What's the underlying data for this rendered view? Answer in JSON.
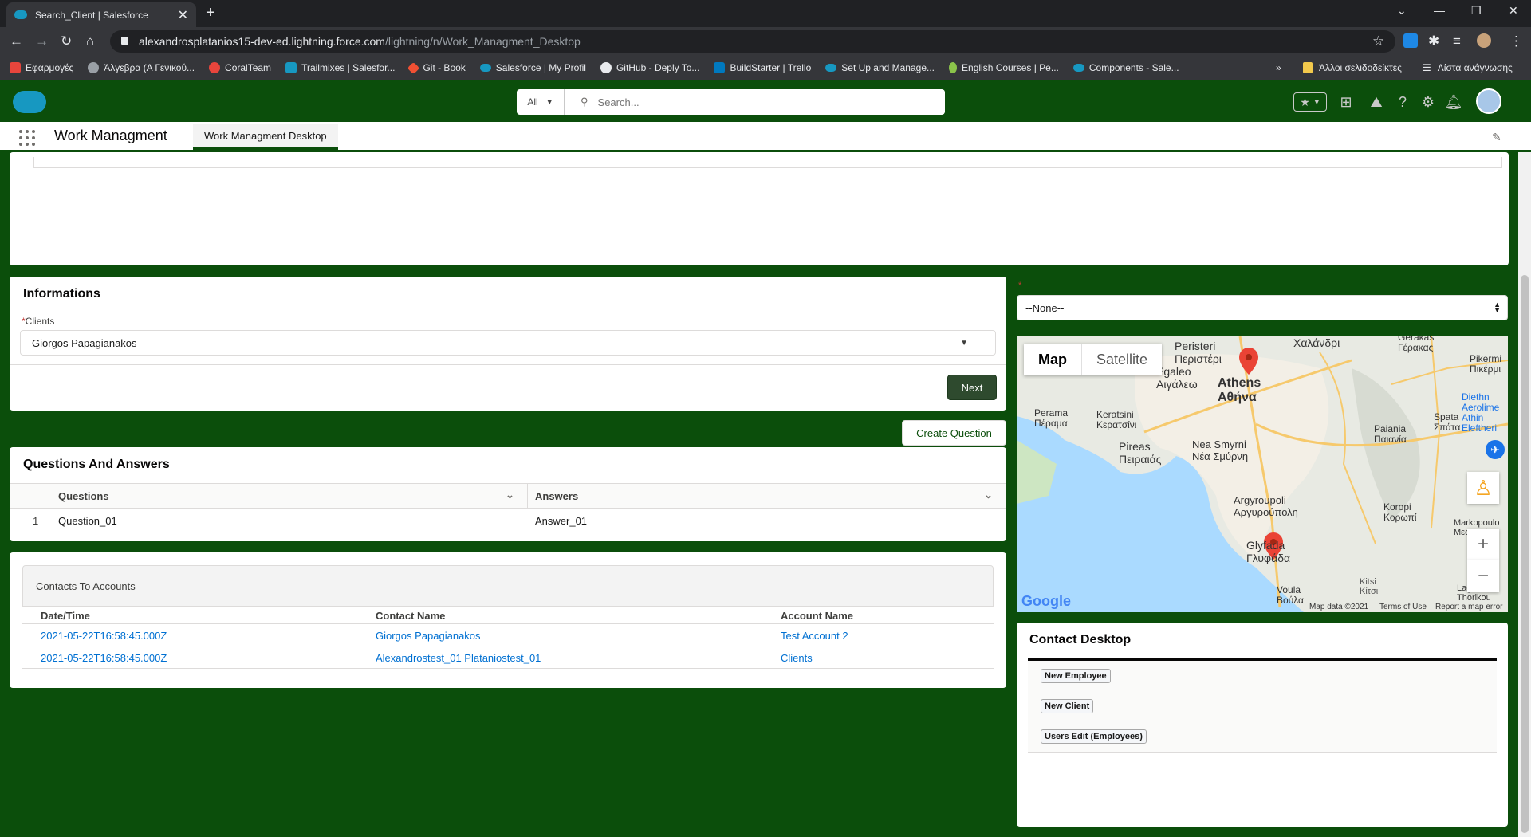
{
  "browser": {
    "tab_title": "Search_Client | Salesforce",
    "url_host": "alexandrosplatanios15-dev-ed.lightning.force.com",
    "url_path": "/lightning/n/Work_Managment_Desktop",
    "bookmarks": [
      {
        "label": "Εφαρμογές",
        "color": "#e8453c"
      },
      {
        "label": "Άλγεβρα (Α Γενικού...",
        "color": "#9aa0a6"
      },
      {
        "label": "CoralTeam",
        "color": "#e8453c"
      },
      {
        "label": "Trailmixes | Salesfor...",
        "color": "#1798c1"
      },
      {
        "label": "Git - Book",
        "color": "#f05033"
      },
      {
        "label": "Salesforce | My Profil",
        "color": "#1798c1"
      },
      {
        "label": "GitHub - Deply To...",
        "color": "#e8eaed"
      },
      {
        "label": "BuildStarter | Trello",
        "color": "#0079bf"
      },
      {
        "label": "Set Up and Manage...",
        "color": "#1798c1"
      },
      {
        "label": "English Courses | Pe...",
        "color": "#8bc34a"
      },
      {
        "label": "Components - Sale...",
        "color": "#1798c1"
      }
    ],
    "bookmarks_overflow": "»",
    "other_bookmarks": "Άλλοι σελιδοδείκτες",
    "reading_list": "Λίστα ανάγνωσης"
  },
  "header": {
    "search_scope": "All",
    "search_placeholder": "Search..."
  },
  "nav": {
    "app_name": "Work Managment",
    "tab_label": "Work Managment Desktop"
  },
  "informations": {
    "title": "Informations",
    "clients_label": "Clients",
    "clients_value": "Giorgos Papagianakos",
    "next_label": "Next"
  },
  "create_question_label": "Create Question",
  "qa": {
    "title": "Questions And Answers",
    "columns": [
      "Questions",
      "Answers"
    ],
    "rows": [
      {
        "num": "1",
        "question": "Question_01",
        "answer": "Answer_01"
      }
    ]
  },
  "contacts": {
    "title": "Contacts To Accounts",
    "columns": [
      "Date/Time",
      "Contact Name",
      "Account Name"
    ],
    "rows": [
      {
        "datetime": "2021-05-22T16:58:45.000Z",
        "contact": "Giorgos Papagianakos",
        "account": "Test Account 2"
      },
      {
        "datetime": "2021-05-22T16:58:45.000Z",
        "contact": "Alexandrostest_01 Plataniostest_01",
        "account": "Clients"
      }
    ]
  },
  "right_select": {
    "value": "--None--"
  },
  "map": {
    "type_map": "Map",
    "type_satellite": "Satellite",
    "places": [
      {
        "name": "Peristeri",
        "alt": "Περιστέρι"
      },
      {
        "name": "Χαλάνδρι",
        "alt": ""
      },
      {
        "name": "Gerakas",
        "alt": "Γέρακας"
      },
      {
        "name": "Pikermi",
        "alt": "Πικέρμι"
      },
      {
        "name": "Egaleo",
        "alt": "Αιγάλεω"
      },
      {
        "name": "Athens",
        "alt": "Αθήνα"
      },
      {
        "name": "Perama",
        "alt": "Πέραμα"
      },
      {
        "name": "Keratsini",
        "alt": "Κερατσίνι"
      },
      {
        "name": "Pireas",
        "alt": "Πειραιάς"
      },
      {
        "name": "Nea Smyrni",
        "alt": "Νέα Σμύρνη"
      },
      {
        "name": "Paiania",
        "alt": "Παιανία"
      },
      {
        "name": "Spata",
        "alt": "Σπάτα"
      },
      {
        "name": "Argyroupoli",
        "alt": "Αργυρούπολη"
      },
      {
        "name": "Koropi",
        "alt": "Κορωπί"
      },
      {
        "name": "Glyfada",
        "alt": "Γλυφάδα"
      },
      {
        "name": "Markopoulo",
        "alt": "Μεσογαίας"
      },
      {
        "name": "Voula",
        "alt": "Βούλα"
      },
      {
        "name": "Kitsi",
        "alt": "Κίτσι"
      },
      {
        "name": "Lagonisi",
        "alt": "Thorikou"
      },
      {
        "name": "Diethn Aerolime Athin Eleftheri",
        "alt": ""
      }
    ],
    "google": "Google",
    "footer_data": "Map data ©2021",
    "footer_terms": "Terms of Use",
    "footer_report": "Report a map error"
  },
  "contact_desktop": {
    "title": "Contact Desktop",
    "buttons": [
      "New Employee",
      "New Client",
      "Users Edit (Employees)"
    ]
  }
}
